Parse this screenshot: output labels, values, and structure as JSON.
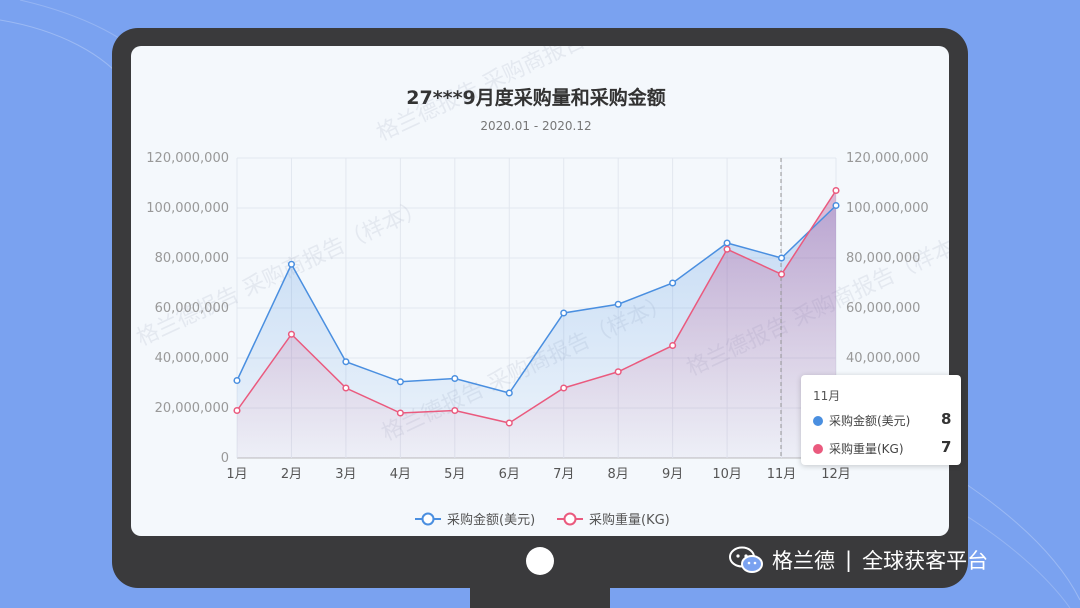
{
  "chart_data": {
    "type": "line",
    "title": "27***9月度采购量和采购金额",
    "subtitle": "2020.01 - 2020.12",
    "categories": [
      "1月",
      "2月",
      "3月",
      "4月",
      "5月",
      "6月",
      "7月",
      "8月",
      "9月",
      "10月",
      "11月",
      "12月"
    ],
    "series": [
      {
        "name": "采购金额(美元)",
        "color": "#4a8fe0",
        "values": [
          31000000,
          77500000,
          38500000,
          30500000,
          31800000,
          26000000,
          58000000,
          61500000,
          70000000,
          86000000,
          80000000,
          101000000
        ]
      },
      {
        "name": "采购重量(KG)",
        "color": "#ea5a7e",
        "values": [
          19000000,
          49500000,
          28000000,
          18000000,
          19000000,
          14000000,
          28000000,
          34500000,
          45000000,
          83500000,
          73500000,
          107000000
        ]
      }
    ],
    "ylim": [
      0,
      120000000
    ],
    "yticks": [
      "0",
      "20,000,000",
      "40,000,000",
      "60,000,000",
      "80,000,000",
      "100,000,000",
      "120,000,000"
    ],
    "grid": true,
    "legend_position": "bottom"
  },
  "tooltip": {
    "title": "11月",
    "rows": [
      {
        "label": "采购金额(美元)",
        "value": "8",
        "color": "#4a8fe0"
      },
      {
        "label": "采购重量(KG)",
        "value": "7",
        "color": "#ea5a7e"
      }
    ]
  },
  "watermark": {
    "text": "格兰德报告 采购商报告（样本）"
  },
  "footer": {
    "brand": "格兰德",
    "separator": "|",
    "slogan": "全球获客平台"
  },
  "icons": {
    "footer_icon": "wechat-icon"
  }
}
